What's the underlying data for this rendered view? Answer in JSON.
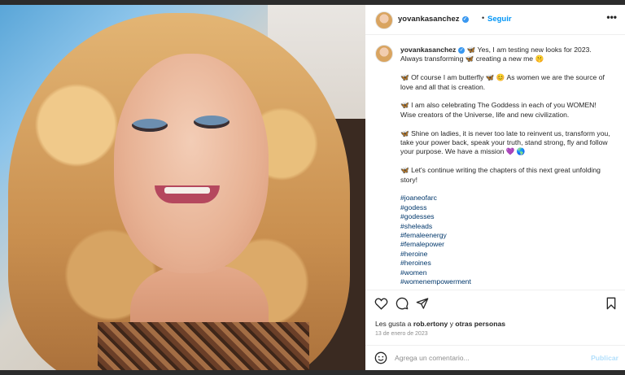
{
  "post": {
    "username": "yovankasanchez",
    "follow_label": "Seguir",
    "separator": "•",
    "more_label": "•••"
  },
  "caption": {
    "username": "yovankasanchez",
    "line1": "🦋 Yes, I am testing new looks for 2023. Always transforming 🦋 creating a new me 🤫",
    "p2": "🦋 Of course I am butterfly 🦋 😊 As women we are the source of love and all that is creation.",
    "p3": "🦋  I am also celebrating The Goddess in each of you WOMEN! Wise creators of the Universe, life and new civilization.",
    "p4": "🦋 Shine on ladies, it is never too late to reinvent us, transform you, take your power back, speak your truth, stand strong, fly and follow your purpose. We have a mission 💜 🌎",
    "p5": "🦋 Let's continue writing the chapters of this next great unfolding story!",
    "hashtags": [
      "#joaneofarc",
      "#godess",
      "#godesses",
      "#sheleads",
      "#femaleenergy",
      "#femalepower",
      "#heroine",
      "#heroines",
      "#women",
      "#womenempowerment"
    ]
  },
  "actions": {
    "likes_prefix": "Les gusta a ",
    "likes_user": "rob.ertony",
    "likes_suffix": " y ",
    "likes_others": "otras personas",
    "date": "13 de enero de 2023"
  },
  "comment_box": {
    "placeholder": "Agrega un comentario...",
    "publish_label": "Publicar"
  },
  "colors": {
    "accent": "#0095f6",
    "link": "#00376b",
    "publish_disabled": "#b2dffc",
    "verified": "#3897f0"
  },
  "icons": [
    "heart-icon",
    "comment-icon",
    "share-icon",
    "bookmark-icon",
    "emoji-icon",
    "verified-icon",
    "more-icon"
  ]
}
